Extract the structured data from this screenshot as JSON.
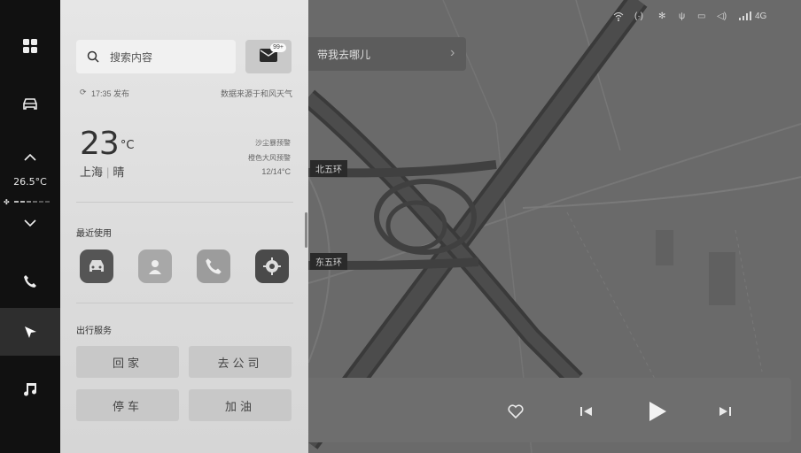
{
  "status_bar": {
    "network": "4G"
  },
  "sidebar": {
    "temperature": "26.5°C",
    "items": [
      {
        "icon": "apps-grid-icon"
      },
      {
        "icon": "car-icon"
      },
      {
        "icon": "chevron-up-icon"
      },
      {
        "icon": "chevron-down-icon"
      },
      {
        "icon": "phone-icon"
      },
      {
        "icon": "navigation-icon",
        "active": true
      },
      {
        "icon": "music-icon"
      }
    ]
  },
  "panel": {
    "search_placeholder": "搜索内容",
    "message_badge": "99+",
    "weather": {
      "publish_time": "17:35 发布",
      "source": "数据来源于和风天气",
      "temperature": "23",
      "unit": "°C",
      "city": "上海",
      "condition": "晴",
      "warnings": [
        "沙尘暴预警",
        "橙色大风预警"
      ],
      "range": "12/14°C"
    },
    "recent_title": "最近使用",
    "recent_apps": [
      {
        "icon": "car-app-icon",
        "color": "#555555"
      },
      {
        "icon": "contact-app-icon",
        "color": "#a9a9a9"
      },
      {
        "icon": "phone-app-icon",
        "color": "#9a9a9a"
      },
      {
        "icon": "settings-app-icon",
        "color": "#4a4a4a"
      }
    ],
    "services_title": "出行服务",
    "services": [
      "回家",
      "去公司",
      "停车",
      "加油"
    ]
  },
  "map": {
    "destination_prompt": "带我去哪儿",
    "road_labels": [
      "北五环",
      "东五环"
    ]
  },
  "media": {
    "controls": [
      {
        "icon": "heart-icon"
      },
      {
        "icon": "previous-icon"
      },
      {
        "icon": "play-icon"
      },
      {
        "icon": "next-icon"
      }
    ]
  }
}
